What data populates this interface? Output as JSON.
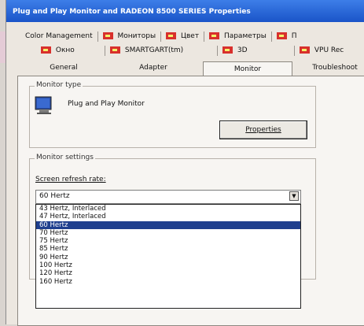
{
  "window": {
    "title": "Plug and Play Monitor and RADEON 8500 SERIES Properties"
  },
  "tabs_row1": [
    {
      "label": "Color Management",
      "icon": "none"
    },
    {
      "label": "Мониторы",
      "icon": "ati-flag-icon"
    },
    {
      "label": "Цвет",
      "icon": "ati-flag-icon"
    },
    {
      "label": "Параметры",
      "icon": "ati-flag-icon"
    },
    {
      "label": "П",
      "icon": "ati-flag-icon"
    }
  ],
  "tabs_row2": [
    {
      "label": "Окно",
      "icon": "ati-flag-icon"
    },
    {
      "label": "SMARTGART(tm)",
      "icon": "ati-flag-icon"
    },
    {
      "label": "3D",
      "icon": "ati-flag-icon"
    },
    {
      "label": "VPU Rec",
      "icon": "ati-flag-icon"
    }
  ],
  "tabs_row3": [
    "General",
    "Adapter",
    "Monitor",
    "Troubleshoot"
  ],
  "active_tab": "Monitor",
  "monitor_type": {
    "legend": "Monitor type",
    "name": "Plug and Play Monitor",
    "properties_button": "Properties"
  },
  "monitor_settings": {
    "legend": "Monitor settings",
    "refresh_label": "Screen refresh rate:",
    "selected": "60 Hertz",
    "options": [
      "43 Hertz, Interlaced",
      "47 Hertz, Interlaced",
      "60 Hertz",
      "70 Hertz",
      "75 Hertz",
      "85 Hertz",
      "90 Hertz",
      "100 Hertz",
      "120 Hertz",
      "160 Hertz"
    ],
    "highlighted_index": 2
  },
  "colors": {
    "title_bar": "#1a54c8",
    "selection": "#1f3f8e",
    "ati_flag": "#d8302c"
  }
}
